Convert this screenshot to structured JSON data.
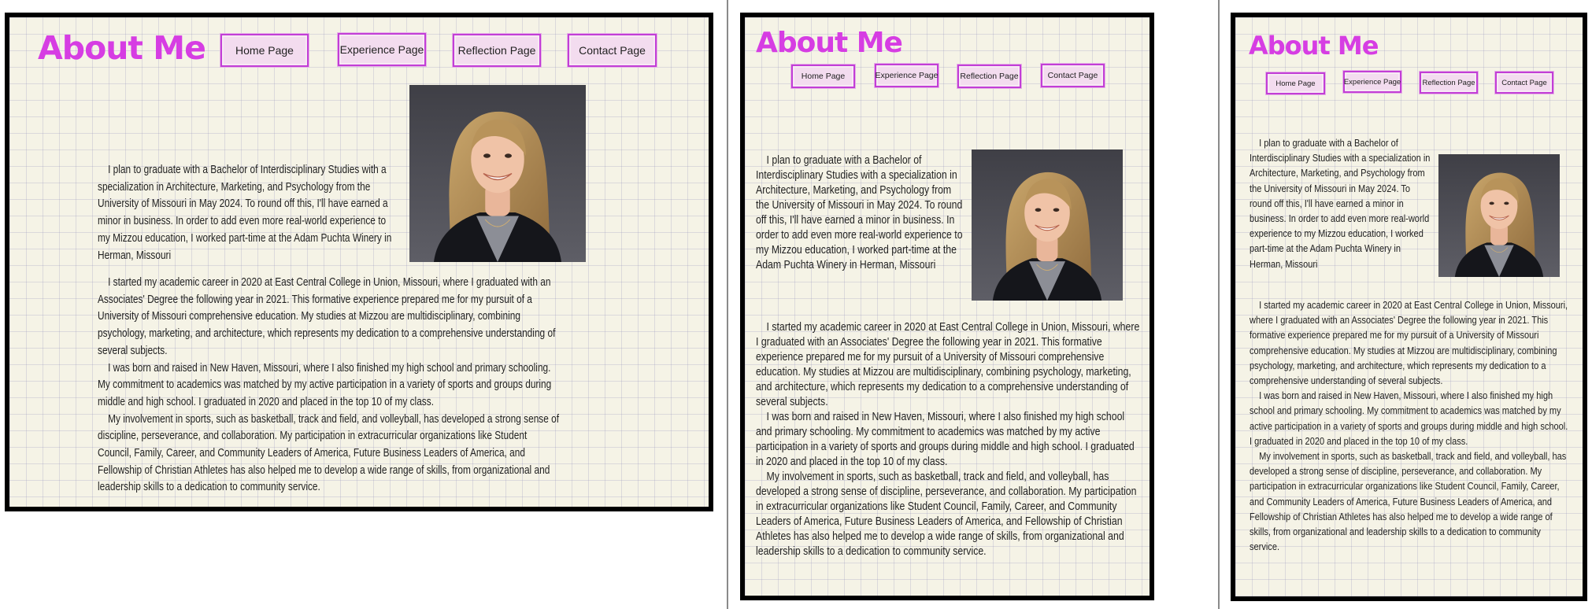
{
  "page": {
    "title": "About Me",
    "nav": {
      "home": "Home Page",
      "experience": "Experience Page",
      "reflection": "Reflection Page",
      "contact": "Contact Page"
    },
    "photo_alt": "Portrait photo",
    "paragraphs": {
      "p1": "I plan to graduate with a Bachelor of Interdisciplinary Studies with a specialization in Architecture, Marketing, and Psychology from the University of Missouri in May 2024. To round off this, I'll have earned a minor in business. In order to add even more real-world experience to my Mizzou education, I worked part-time at the Adam Puchta Winery in Herman, Missouri",
      "p2": "I started my academic career in 2020 at East Central College in Union, Missouri, where I graduated with an Associates' Degree the following year in 2021. This formative experience prepared me for my pursuit of a University of Missouri comprehensive education. My studies at Mizzou are multidisciplinary, combining psychology, marketing, and architecture, which represents my dedication to a comprehensive understanding of several subjects.",
      "p3": "I was born and raised in New Haven, Missouri, where I also finished my high school and primary schooling. My commitment to academics was matched by my active participation in a variety of sports and groups during middle and high school. I graduated in 2020 and placed in the top 10 of my class.",
      "p4": "My involvement in sports, such as basketball, track and field, and volleyball, has developed a strong sense of discipline, perseverance, and collaboration. My participation in extracurricular organizations like Student Council, Family, Career, and Community Leaders of America, Future Business Leaders of America, and Fellowship of Christian Athletes has also helped me to develop a wide range of skills, from organizational and leadership skills to a dedication to community service."
    }
  },
  "colors": {
    "accent": "#d63de3",
    "button_fill": "#f3dcef",
    "button_border": "#c23ed6",
    "paper": "#f5f3e6",
    "frame": "#000000"
  }
}
